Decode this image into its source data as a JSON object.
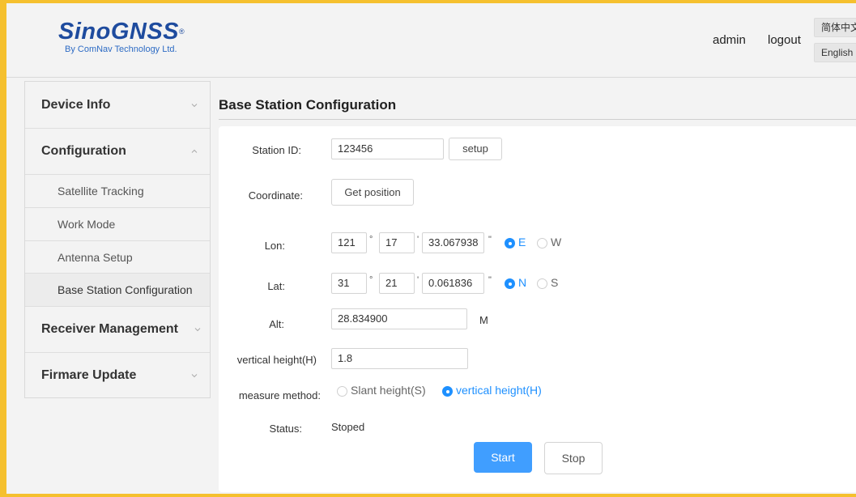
{
  "header": {
    "logo_main": "SinoGNSS",
    "logo_reg": "®",
    "logo_sub": "By ComNav Technology Ltd.",
    "user": "admin",
    "logout": "logout",
    "lang_zh": "简体中文",
    "lang_en": "English"
  },
  "sidebar": {
    "items": [
      {
        "label": "Device Info",
        "icon": "chevron-down-icon"
      },
      {
        "label": "Configuration",
        "icon": "chevron-up-icon"
      },
      {
        "label": "Satellite Tracking"
      },
      {
        "label": "Work Mode"
      },
      {
        "label": "Antenna Setup"
      },
      {
        "label": "Base Station Configuration"
      },
      {
        "label": "Receiver Management",
        "icon": "chevron-down-icon"
      },
      {
        "label": "Firmare Update",
        "icon": "chevron-down-icon"
      }
    ]
  },
  "main": {
    "title": "Base Station Configuration",
    "station_id_label": "Station ID:",
    "station_id_value": "123456",
    "setup_button": "setup",
    "coordinate_label": "Coordinate:",
    "get_position_button": "Get position",
    "lon": {
      "label": "Lon:",
      "deg": "121",
      "min": "17",
      "sec": "33.067938",
      "deg_sym": "°",
      "min_sym": "'",
      "sec_sym": "\"",
      "opt_selected": "E",
      "opt_other": "W"
    },
    "lat": {
      "label": "Lat:",
      "deg": "31",
      "min": "21",
      "sec": "0.061836",
      "deg_sym": "°",
      "min_sym": "'",
      "sec_sym": "\"",
      "opt_selected": "N",
      "opt_other": "S"
    },
    "alt": {
      "label": "Alt:",
      "value": "28.834900",
      "unit": "M"
    },
    "vheight": {
      "label": "vertical height(H)",
      "value": "1.8"
    },
    "measure": {
      "label": "measure method:",
      "opt_slant": "Slant height(S)",
      "opt_vertical": "vertical height(H)",
      "selected": "vertical height(H)"
    },
    "status": {
      "label": "Status:",
      "value": "Stoped"
    },
    "start_button": "Start",
    "stop_button": "Stop"
  },
  "colors": {
    "accent": "#409eff",
    "radio_on": "#1e90ff",
    "logo": "#1e4b9e",
    "frame_border": "#f5c02e"
  }
}
